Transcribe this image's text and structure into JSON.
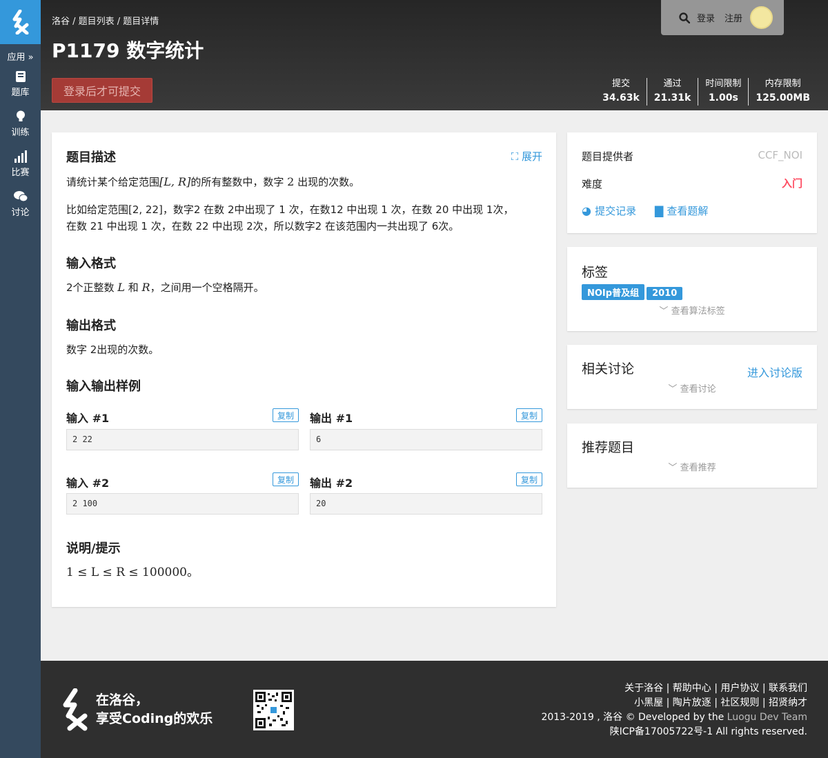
{
  "sidebar": {
    "apps_label": "应用",
    "items": [
      {
        "label": "题库",
        "icon": "book-icon"
      },
      {
        "label": "训练",
        "icon": "lightbulb-icon"
      },
      {
        "label": "比赛",
        "icon": "signal-bars-icon"
      },
      {
        "label": "讨论",
        "icon": "chat-bubbles-icon"
      }
    ]
  },
  "header": {
    "breadcrumb": "洛谷 / 题目列表 / 题目详情",
    "title": "P1179 数字统计",
    "submit_label": "登录后才可提交",
    "login_label": "登录",
    "register_label": "注册",
    "stats": [
      {
        "label": "提交",
        "value": "34.63k"
      },
      {
        "label": "通过",
        "value": "21.31k"
      },
      {
        "label": "时间限制",
        "value": "1.00s"
      },
      {
        "label": "内存限制",
        "value": "125.00MB"
      }
    ]
  },
  "problem": {
    "desc_title": "题目描述",
    "expand_label": "展开",
    "desc_p1_a": "请统计某个给定范围",
    "desc_p1_range": "[L, R]",
    "desc_p1_b": "的所有整数中，数字",
    "desc_p1_digit": "2",
    "desc_p1_c": "出现的次数。",
    "desc_p2_line1": "比如给定范围[2, 22]，数字2 在数 2中出现了 1 次，在数12 中出现 1 次，在数 20 中出现 1次，",
    "desc_p2_line2": "在数 21 中出现 1 次，在数 22 中出现 2次，所以数字2 在该范围内一共出现了 6次。",
    "input_title": "输入格式",
    "input_a": "2个正整数",
    "input_L": "L",
    "input_and": "和",
    "input_R": "R",
    "input_b": "，之间用一个空格隔开。",
    "output_title": "输出格式",
    "output_text": "数字 2出现的次数。",
    "samples_title": "输入输出样例",
    "copy_label": "复制",
    "samples": [
      {
        "in_label": "输入 #1",
        "out_label": "输出 #1",
        "in": "2 22",
        "out": "6"
      },
      {
        "in_label": "输入 #2",
        "out_label": "输出 #2",
        "in": "2 100",
        "out": "20"
      }
    ],
    "hint_title": "说明/提示",
    "hint_text": "1 ≤ L ≤ R ≤ 100000。"
  },
  "info": {
    "provider_label": "题目提供者",
    "provider_value": "CCF_NOI",
    "difficulty_label": "难度",
    "difficulty_value": "入门",
    "difficulty_color": "#fe4c61",
    "records_link": "提交记录",
    "solutions_link": "查看题解"
  },
  "tags": {
    "title": "标签",
    "items": [
      "NOIp普及组",
      "2010"
    ],
    "more": "查看算法标签"
  },
  "discuss": {
    "title": "相关讨论",
    "enter_link": "进入讨论版",
    "more": "查看讨论"
  },
  "recommend": {
    "title": "推荐题目",
    "more": "查看推荐"
  },
  "footer": {
    "slogan_line1": "在洛谷，",
    "slogan_line2": "享受Coding的欢乐",
    "links_row1": "关于洛谷 | 帮助中心 | 用户协议 | 联系我们",
    "links_row2": "小黑屋 | 陶片放逐 | 社区规则 | 招贤纳才",
    "copyright_a": "2013-2019 , 洛谷 © Developed by the",
    "copyright_team": "Luogu Dev Team",
    "icp": "陕ICP备17005722号-1 All rights reserved."
  },
  "colors": {
    "brand_blue": "#3498db",
    "sidebar": "#34495e",
    "submit_red": "#a53b36"
  }
}
